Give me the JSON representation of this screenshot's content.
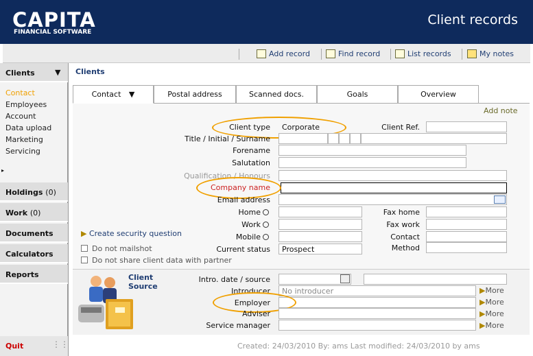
{
  "brand": {
    "logo": "CAPITA",
    "sub": "FINANCIAL SOFTWARE"
  },
  "app_title": "Client records",
  "toolbar": {
    "add": "Add record",
    "find": "Find record",
    "list": "List records",
    "notes": "My notes"
  },
  "sidebar": {
    "clients_label": "Clients",
    "items": [
      "Contact",
      "Employees",
      "Account",
      "Data upload",
      "Marketing",
      "Servicing"
    ],
    "holdings": "Holdings",
    "holdings_count": "(0)",
    "work": "Work",
    "work_count": "(0)",
    "documents": "Documents",
    "calculators": "Calculators",
    "reports": "Reports",
    "quit": "Quit"
  },
  "breadcrumb": "Clients",
  "tabs": [
    "Contact",
    "Postal address",
    "Scanned docs.",
    "Goals",
    "Overview"
  ],
  "add_note": "Add note",
  "form": {
    "client_type_label": "Client type",
    "client_type_value": "Corporate",
    "client_ref_label": "Client Ref.",
    "title_label": "Title / Initial / Surname",
    "forename_label": "Forename",
    "salutation_label": "Salutation",
    "qualification_label": "Qualification / Honours",
    "company_label": "Company name",
    "email_label": "Email address",
    "home_label": "Home",
    "work_label": "Work",
    "mobile_label": "Mobile",
    "fax_home_label": "Fax home",
    "fax_work_label": "Fax work",
    "contact_label": "Contact",
    "method_label": "Method",
    "status_label": "Current status",
    "status_value": "Prospect",
    "security_link": "Create security question",
    "mailshot_label": "Do not mailshot",
    "share_label": "Do not share client data with partner"
  },
  "lower": {
    "section_title_1": "Client",
    "section_title_2": "Source",
    "intro_label": "Intro. date / source",
    "introducer_label": "Introducer",
    "introducer_placeholder": "No introducer",
    "employer_label": "Employer",
    "adviser_label": "Adviser",
    "service_manager_label": "Service manager",
    "more": "More"
  },
  "footer": "Created: 24/03/2010  By: ams  Last modified: 24/03/2010 by ams",
  "colors": {
    "header": "#0e2a5c",
    "accent": "#f0a000",
    "nav_active": "#f0a000",
    "company_label": "#cc2222"
  }
}
